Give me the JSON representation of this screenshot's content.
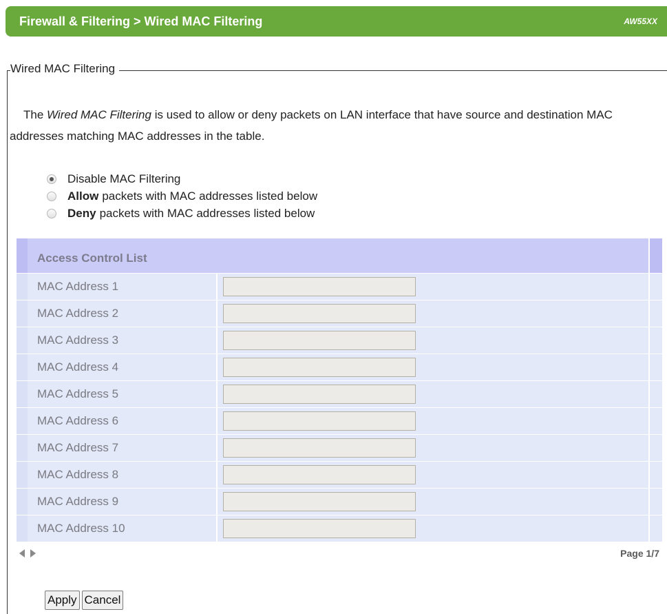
{
  "header": {
    "title": "Firewall & Filtering > Wired MAC Filtering",
    "model": "AW55XX",
    "color": "#6aaa3c"
  },
  "section": {
    "legend": "Wired MAC Filtering"
  },
  "description": {
    "prefix": "The ",
    "emphasis": "Wired MAC Filtering",
    "suffix": " is used to allow or deny packets on LAN interface that have source and destination MAC addresses matching MAC addresses in the table."
  },
  "mode_options": [
    {
      "bold": "",
      "label": "Disable MAC Filtering",
      "selected": true
    },
    {
      "bold": "Allow",
      "label": "packets with MAC addresses listed below",
      "selected": false
    },
    {
      "bold": "Deny",
      "label": "packets with MAC addresses listed below",
      "selected": false
    }
  ],
  "acl": {
    "title": "Access Control List",
    "rows": [
      {
        "label": "MAC Address 1",
        "value": ""
      },
      {
        "label": "MAC Address 2",
        "value": ""
      },
      {
        "label": "MAC Address 3",
        "value": ""
      },
      {
        "label": "MAC Address 4",
        "value": ""
      },
      {
        "label": "MAC Address 5",
        "value": ""
      },
      {
        "label": "MAC Address 6",
        "value": ""
      },
      {
        "label": "MAC Address 7",
        "value": ""
      },
      {
        "label": "MAC Address 8",
        "value": ""
      },
      {
        "label": "MAC Address 9",
        "value": ""
      },
      {
        "label": "MAC Address 10",
        "value": ""
      }
    ]
  },
  "pager": {
    "page_label": "Page 1/7"
  },
  "buttons": {
    "apply": "Apply",
    "cancel": "Cancel"
  }
}
